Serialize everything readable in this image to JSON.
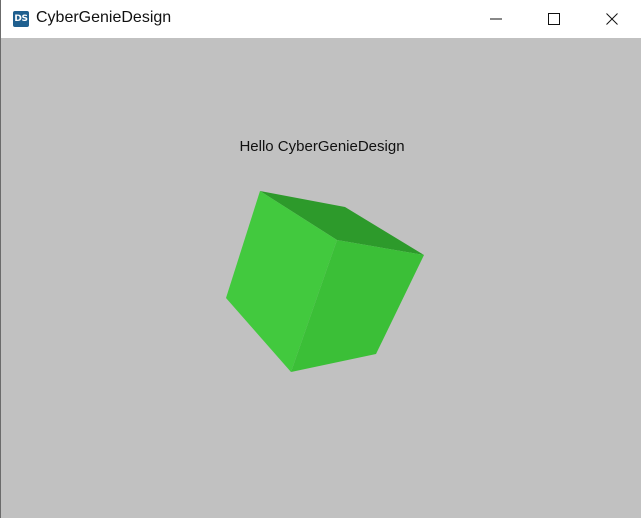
{
  "window": {
    "title": "CyberGenieDesign",
    "icon_label": "DS",
    "icon": "app-logo-icon"
  },
  "controls": {
    "minimize_icon": "minimize-icon",
    "maximize_icon": "maximize-icon",
    "close_icon": "close-icon"
  },
  "content": {
    "greeting": "Hello CyberGenieDesign",
    "background_color": "#c1c1c1",
    "cube_colors": {
      "top": "#2d9a2b",
      "left": "#42c93e",
      "right": "#3bbf37"
    }
  }
}
